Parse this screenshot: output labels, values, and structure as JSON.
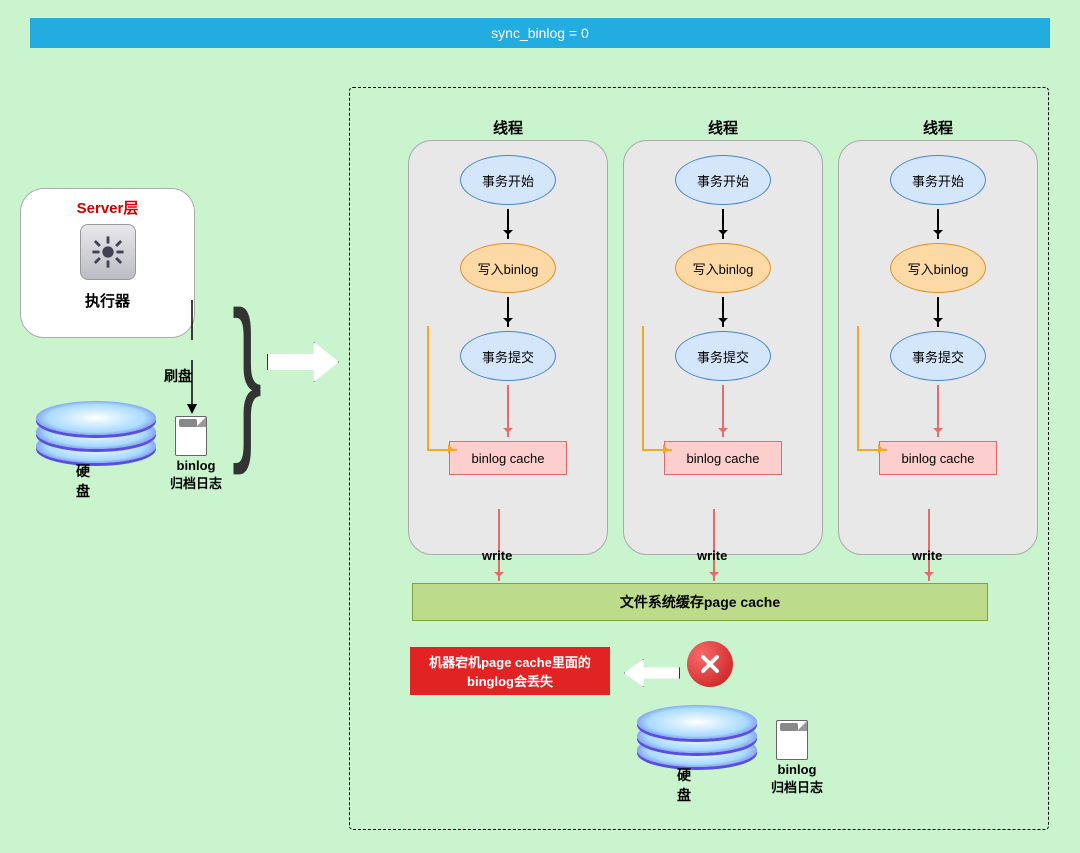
{
  "header_title": "sync_binlog = 0",
  "server": {
    "title": "Server层",
    "executor": "执行器",
    "flush_label": "刷盘"
  },
  "disk_left": {
    "hard_disk": "硬盘",
    "binlog": "binlog",
    "archive": "归档日志"
  },
  "threads": {
    "title": "线程",
    "tx_start": "事务开始",
    "write_binlog": "写入binlog",
    "tx_commit": "事务提交",
    "binlog_cache": "binlog cache",
    "write": "write"
  },
  "pagecache": "文件系统缓存page cache",
  "error_text": "机器宕机page cache里面的binglog会丢失",
  "disk_bottom": {
    "hard_disk": "硬盘",
    "binlog": "binlog",
    "archive": "归档日志"
  }
}
